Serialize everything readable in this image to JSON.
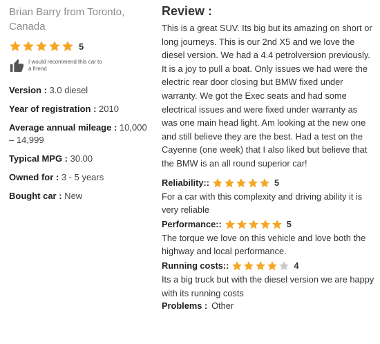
{
  "reviewer": {
    "name": "Brian Barry from Toronto, Canada",
    "rating": 5,
    "rating_label": "5"
  },
  "recommend": {
    "text": "I would recommend this car to a friend"
  },
  "specs": [
    {
      "label": "Version :",
      "value": " 3.0 diesel"
    },
    {
      "label": "Year of registration :",
      "value": " 2010"
    },
    {
      "label": "Average annual mileage :",
      "value": " 10,000 – 14,999"
    },
    {
      "label": "Typical MPG :",
      "value": " 30.00"
    },
    {
      "label": "Owned for :",
      "value": " 3 - 5 years"
    },
    {
      "label": "Bought car :",
      "value": " New"
    }
  ],
  "review": {
    "title": "Review :",
    "body": "This is a great SUV. Its big but its amazing on short or long journeys. This is our 2nd X5 and we love the diesel version. We had a 4.4 petrolversion previously. It is a joy to pull a boat. Only issues we had were the electric rear door closing but BMW fixed under warranty. We got the Exec seats and had some electrical issues and were fixed under warranty as was one main head light. Am looking at the new one and still believe they are the best. Had a test on the Cayenne (one week) that I also liked but believe that the BMW is an all round superior car!"
  },
  "sub_ratings": [
    {
      "label": "Reliability::",
      "rating": 5,
      "rating_label": "5",
      "text": "For a car with this complexity and driving ability it is very reliable"
    },
    {
      "label": "Performance::",
      "rating": 5,
      "rating_label": "5",
      "text": "The torque we love on this vehicle and love both the highway and local performance."
    },
    {
      "label": "Running costs::",
      "rating": 4,
      "rating_label": "4",
      "text": "Its a big truck but with the diesel version we are happy with its running costs"
    }
  ],
  "problems": {
    "label": "Problems :",
    "value": "Other"
  },
  "colors": {
    "star_filled": "#f5a623",
    "star_empty": "#c8c8c8",
    "muted_text": "#8a8a8a"
  },
  "icons": {
    "star": "star-icon",
    "thumb": "thumbs-up-icon"
  }
}
